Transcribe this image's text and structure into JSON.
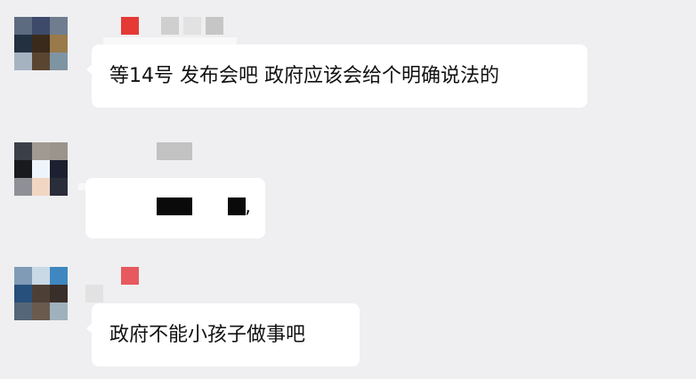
{
  "colors": {
    "background": "#efeff1",
    "bubble": "#ffffff",
    "text": "#111111",
    "badge_red": "#e53935",
    "badge_red_light": "#e65a5f",
    "name_gray": "#c4c4c4",
    "redaction": "#0a0a0a"
  },
  "messages": [
    {
      "sender_blurred": true,
      "avatar_blurred": true,
      "text": "等14号 发布会吧 政府应该会给个明确说法的"
    },
    {
      "sender_blurred": true,
      "avatar_blurred": true,
      "text": "",
      "redacted": true,
      "visible_punctuation": ","
    },
    {
      "sender_blurred": true,
      "avatar_blurred": true,
      "text": "政府不能小孩子做事吧"
    }
  ]
}
